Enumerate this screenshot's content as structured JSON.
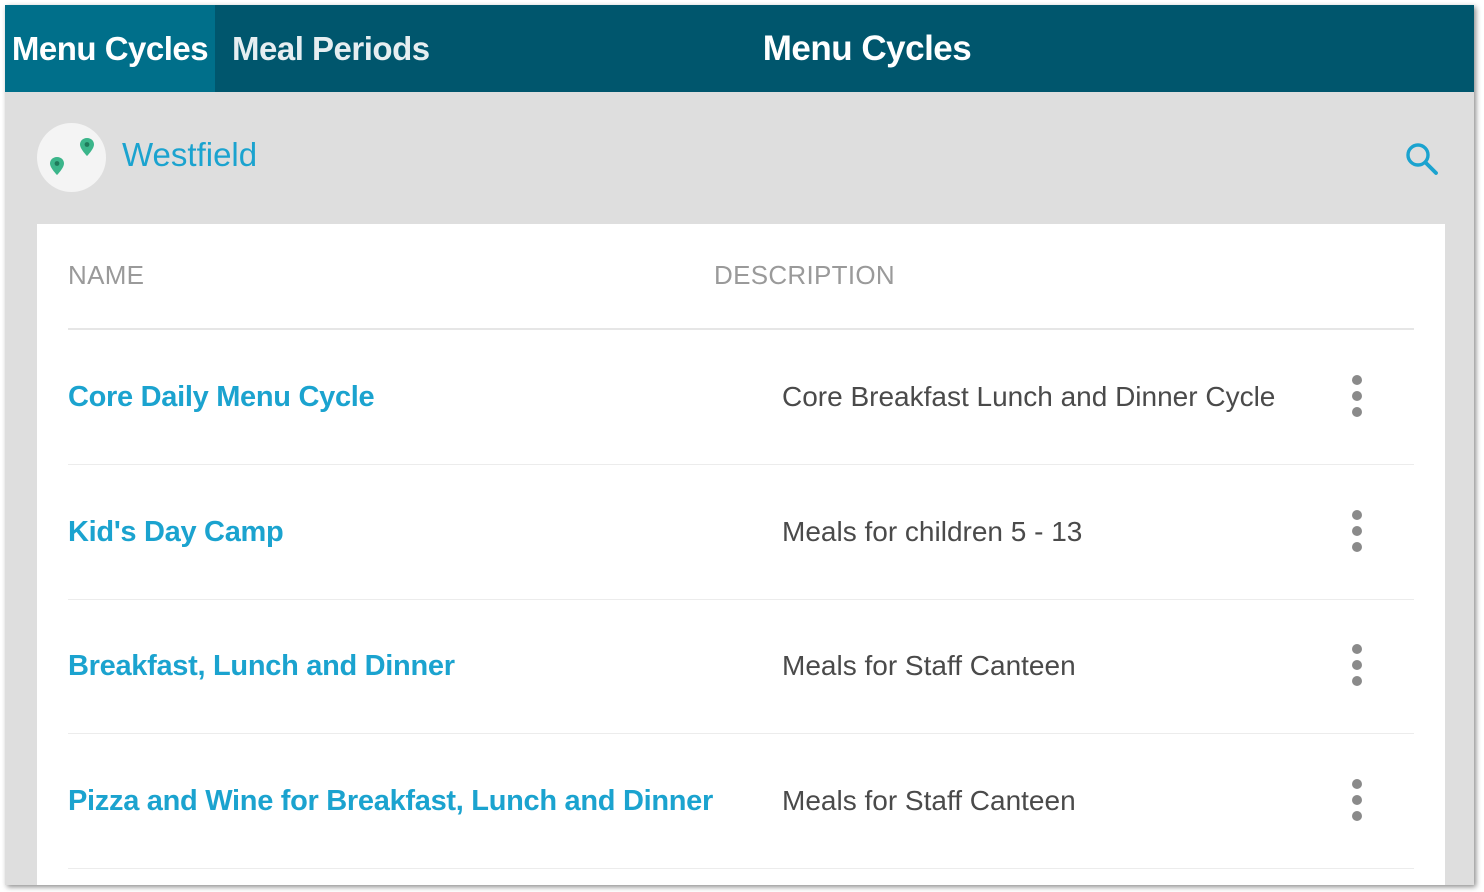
{
  "header": {
    "tabs": [
      {
        "label": "Menu Cycles",
        "active": true
      },
      {
        "label": "Meal Periods",
        "active": false
      }
    ],
    "title": "Menu Cycles",
    "background_color": "#00566d",
    "active_tab_color": "#006f8a"
  },
  "location": {
    "name": "Westfield",
    "icon": "map-pins-icon",
    "search_icon": "search-icon"
  },
  "table": {
    "columns": [
      "NAME",
      "DESCRIPTION"
    ],
    "rows": [
      {
        "name": "Core Daily Menu Cycle",
        "description": "Core Breakfast Lunch and Dinner Cycle"
      },
      {
        "name": "Kid's Day Camp",
        "description": "Meals for children 5 - 13"
      },
      {
        "name": "Breakfast, Lunch and Dinner",
        "description": "Meals for Staff Canteen"
      },
      {
        "name": "Pizza and Wine for Breakfast, Lunch and Dinner",
        "description": "Meals for Staff Canteen"
      }
    ],
    "row_action_icon": "more-vertical-icon"
  },
  "colors": {
    "link": "#1ba3cf",
    "text": "#4a4a4a",
    "header_text": "#9a9a9a",
    "pin": "#3bb58a"
  }
}
